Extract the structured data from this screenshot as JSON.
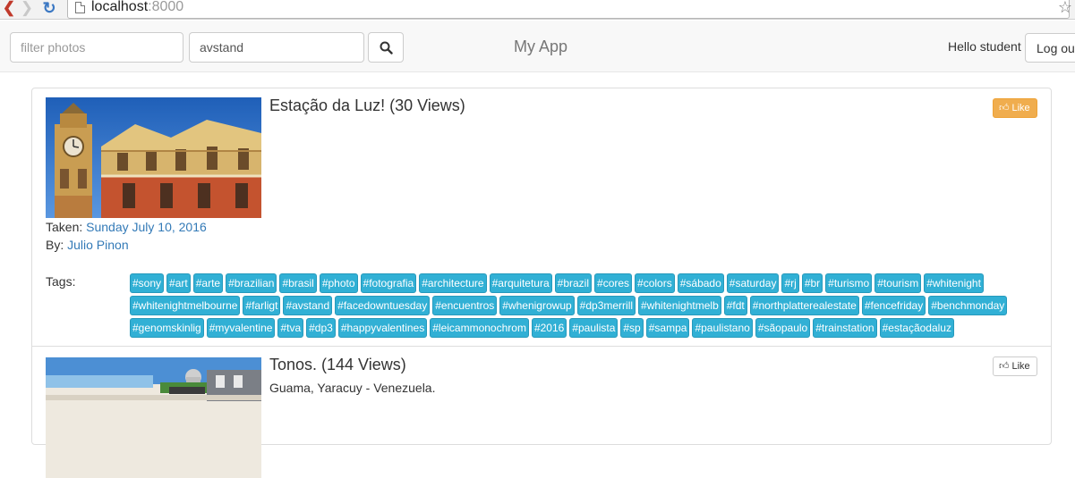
{
  "browser": {
    "url_host": "localhost",
    "url_port": ":8000"
  },
  "navbar": {
    "filter_placeholder": "filter photos",
    "search_value": "avstand",
    "brand": "My App",
    "greeting": "Hello student",
    "logout_label": "Log ou"
  },
  "photos": [
    {
      "title": "Estação da Luz! (30 Views)",
      "like_label": "Like",
      "taken_label": "Taken:",
      "taken_date": "Sunday July 10, 2016",
      "by_label": "By:",
      "author": "Julio Pinon",
      "tags_label": "Tags:",
      "tags": [
        "#sony",
        "#art",
        "#arte",
        "#brazilian",
        "#brasil",
        "#photo",
        "#fotografia",
        "#architecture",
        "#arquitetura",
        "#brazil",
        "#cores",
        "#colors",
        "#sábado",
        "#saturday",
        "#rj",
        "#br",
        "#turismo",
        "#tourism",
        "#whitenight",
        "#whitenightmelbourne",
        "#farligt",
        "#avstand",
        "#facedowntuesday",
        "#encuentros",
        "#whenigrowup",
        "#dp3merrill",
        "#whitenightmelb",
        "#fdt",
        "#northplatterealestate",
        "#fencefriday",
        "#benchmonday",
        "#genomskinlig",
        "#myvalentine",
        "#tva",
        "#dp3",
        "#happyvalentines",
        "#leicammonochrom",
        "#2016",
        "#paulista",
        "#sp",
        "#sampa",
        "#paulistano",
        "#sãopaulo",
        "#trainstation",
        "#estaçãodaluz"
      ]
    },
    {
      "title": "Tonos. (144 Views)",
      "description": "Guama, Yaracuy - Venezuela.",
      "like_label": "Like"
    }
  ],
  "colors": {
    "like_active": "#f0ad4e",
    "tag_bg": "#31b0d5",
    "link": "#337ab7"
  }
}
